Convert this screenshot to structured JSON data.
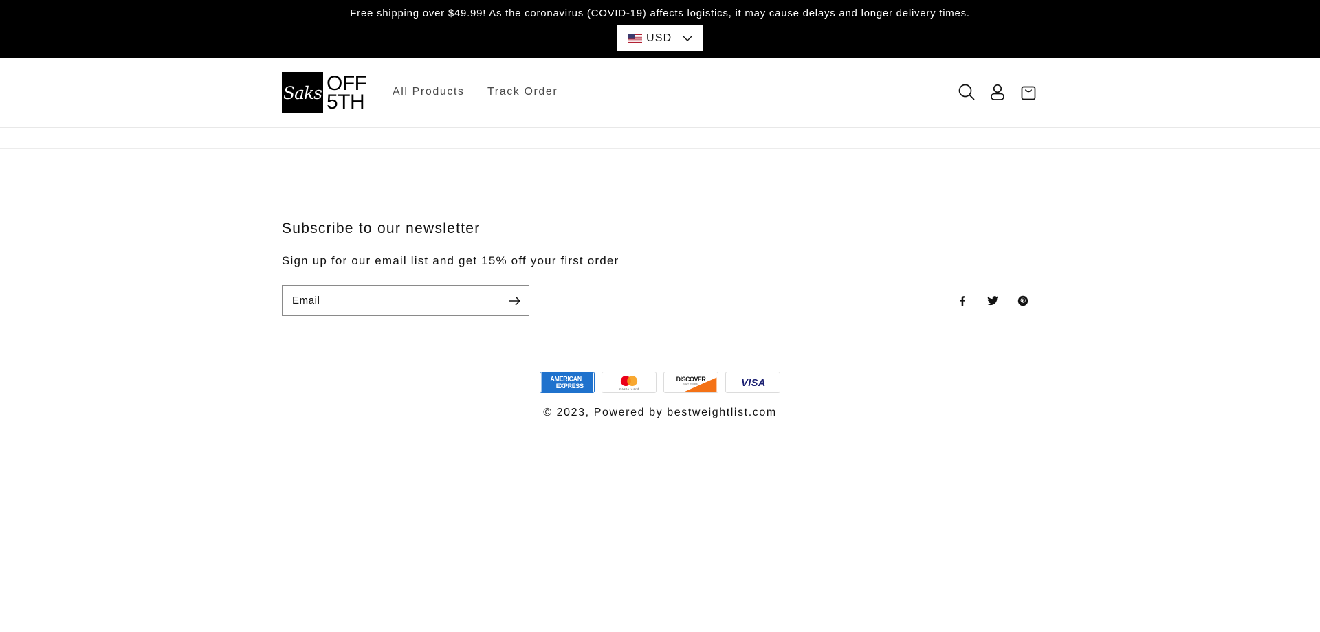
{
  "announcement": {
    "text": "Free shipping over $49.99! As the coronavirus (COVID-19) affects logistics, it may cause delays and longer delivery times."
  },
  "currency": {
    "selected": "USD",
    "flag_icon": "us-flag-icon"
  },
  "header": {
    "logo": {
      "mark": "Saks",
      "line1": "OFF",
      "line2": "5TH"
    },
    "nav": [
      {
        "label": "All Products"
      },
      {
        "label": "Track Order"
      }
    ],
    "icons": [
      "search-icon",
      "account-icon",
      "cart-icon"
    ]
  },
  "newsletter": {
    "heading": "Subscribe to our newsletter",
    "subtext": "Sign up for our email list and get 15% off your first order",
    "email_placeholder": "Email",
    "submit_icon": "arrow-right-icon"
  },
  "social": [
    "facebook-icon",
    "twitter-icon",
    "pinterest-icon"
  ],
  "payments": [
    "American Express",
    "Mastercard",
    "Discover",
    "Visa"
  ],
  "payment_text": {
    "amex_line1": "AMERICAN",
    "amex_line2": "EXPRESS",
    "mastercard": "mastercard",
    "discover": "DISCOVER",
    "discover_sub": "NETWORK",
    "visa": "VISA"
  },
  "footer": {
    "copyright_prefix": "© 2023, ",
    "powered": "Powered by bestweightlist.com"
  },
  "colors": {
    "announcement_bg": "#000000",
    "text": "#121212",
    "amex_blue": "#1f72cd",
    "visa_blue": "#1a1f71",
    "discover_orange": "#f47216",
    "mc_red": "#eb001b",
    "mc_yellow": "#f79e1b"
  }
}
